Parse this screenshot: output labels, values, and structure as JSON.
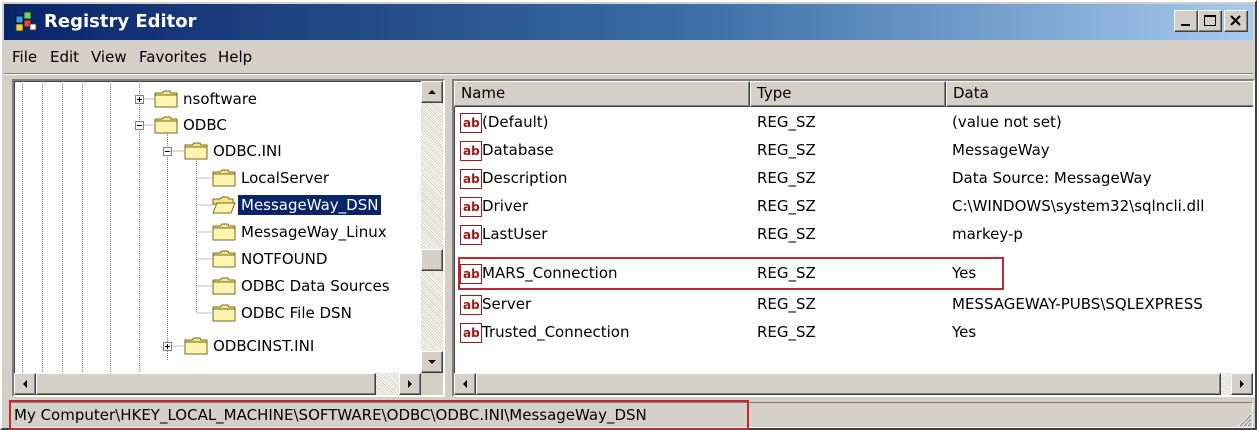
{
  "window": {
    "title": "Registry Editor"
  },
  "menu": [
    "File",
    "Edit",
    "View",
    "Favorites",
    "Help"
  ],
  "tree": [
    {
      "label": "nsoftware",
      "expander": "plus",
      "selected": false
    },
    {
      "label": "ODBC",
      "expander": "minus",
      "selected": false
    },
    {
      "label": "ODBC.INI",
      "expander": "minus",
      "selected": false
    },
    {
      "label": "LocalServer",
      "expander": "none",
      "selected": false
    },
    {
      "label": "MessageWay_DSN",
      "expander": "none",
      "selected": true
    },
    {
      "label": "MessageWay_Linux",
      "expander": "none",
      "selected": false
    },
    {
      "label": "NOTFOUND",
      "expander": "none",
      "selected": false
    },
    {
      "label": "ODBC Data Sources",
      "expander": "none",
      "selected": false
    },
    {
      "label": "ODBC File DSN",
      "expander": "none",
      "selected": false
    },
    {
      "label": "ODBCINST.INI",
      "expander": "plus",
      "selected": false
    }
  ],
  "list": {
    "columns": [
      "Name",
      "Type",
      "Data"
    ],
    "rows": [
      {
        "name": "(Default)",
        "type": "REG_SZ",
        "data": "(value not set)",
        "highlighted": false
      },
      {
        "name": "Database",
        "type": "REG_SZ",
        "data": "MessageWay",
        "highlighted": false
      },
      {
        "name": "Description",
        "type": "REG_SZ",
        "data": "Data Source: MessageWay",
        "highlighted": false
      },
      {
        "name": "Driver",
        "type": "REG_SZ",
        "data": "C:\\WINDOWS\\system32\\sqlncli.dll",
        "highlighted": false
      },
      {
        "name": "LastUser",
        "type": "REG_SZ",
        "data": "markey-p",
        "highlighted": false
      },
      {
        "name": "MARS_Connection",
        "type": "REG_SZ",
        "data": "Yes",
        "highlighted": true
      },
      {
        "name": "Server",
        "type": "REG_SZ",
        "data": "MESSAGEWAY-PUBS\\SQLEXPRESS",
        "highlighted": false
      },
      {
        "name": "Trusted_Connection",
        "type": "REG_SZ",
        "data": "Yes",
        "highlighted": false
      }
    ]
  },
  "status": {
    "path": "My Computer\\HKEY_LOCAL_MACHINE\\SOFTWARE\\ODBC\\ODBC.INI\\MessageWay_DSN"
  },
  "colors": {
    "titlebar_start": "#0a246a",
    "titlebar_end": "#a6caf0",
    "selection": "#0a246a",
    "annotation": "#c1272d",
    "face": "#d4d0c8"
  },
  "icons": {
    "app": "registry-icon",
    "folder": "folder-icon",
    "open_folder": "open-folder-icon",
    "value": "string-value-icon"
  }
}
